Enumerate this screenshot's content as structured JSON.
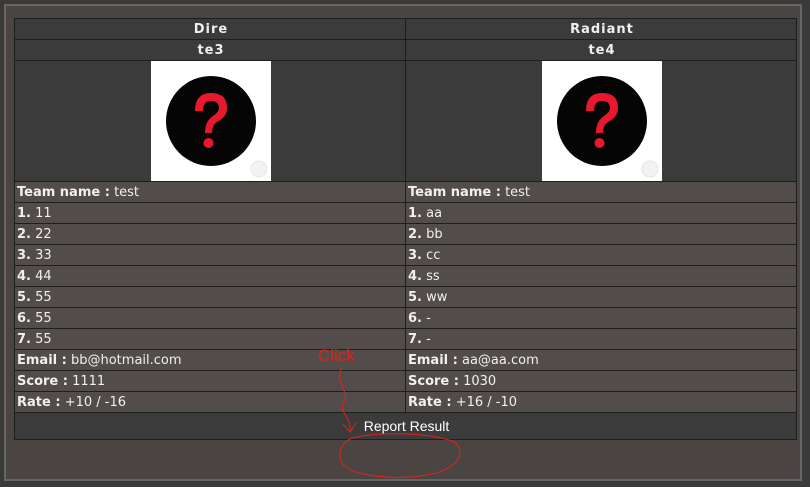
{
  "teams": [
    {
      "side": "Dire",
      "tag": "te3",
      "logo_icon": "question-mark-icon",
      "team_name_label": "Team name :",
      "team_name": "test",
      "players": [
        {
          "num": "1.",
          "name": "11"
        },
        {
          "num": "2.",
          "name": "22"
        },
        {
          "num": "3.",
          "name": "33"
        },
        {
          "num": "4.",
          "name": "44"
        },
        {
          "num": "5.",
          "name": "55"
        },
        {
          "num": "6.",
          "name": "55"
        },
        {
          "num": "7.",
          "name": "55"
        }
      ],
      "email_label": "Email :",
      "email": "bb@hotmail.com",
      "score_label": "Score :",
      "score": "1111",
      "rate_label": "Rate :",
      "rate": "+10 / -16"
    },
    {
      "side": "Radiant",
      "tag": "te4",
      "logo_icon": "question-mark-icon",
      "team_name_label": "Team name :",
      "team_name": "test",
      "players": [
        {
          "num": "1.",
          "name": "aa"
        },
        {
          "num": "2.",
          "name": "bb"
        },
        {
          "num": "3.",
          "name": "cc"
        },
        {
          "num": "4.",
          "name": "ss"
        },
        {
          "num": "5.",
          "name": "ww"
        },
        {
          "num": "6.",
          "name": "-"
        },
        {
          "num": "7.",
          "name": "-"
        }
      ],
      "email_label": "Email :",
      "email": "aa@aa.com",
      "score_label": "Score :",
      "score": "1030",
      "rate_label": "Rate :",
      "rate": "+16 / -10"
    }
  ],
  "action": {
    "report_label": "Report Result"
  },
  "annotation": {
    "text": "Click",
    "color": "#e0231c"
  },
  "colors": {
    "tag": "#e8a70c",
    "row_bg": "#524c4b",
    "header_bg": "#3b3b3b"
  }
}
